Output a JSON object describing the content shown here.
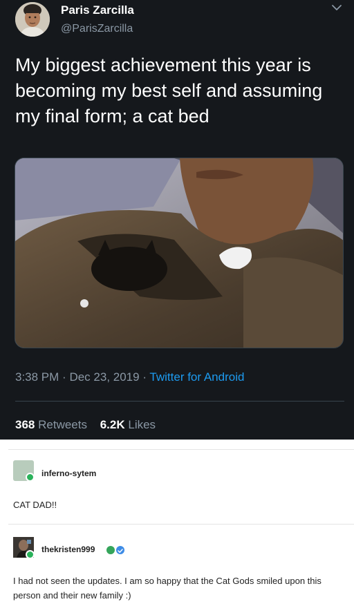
{
  "tweet": {
    "author_name": "Paris Zarcilla",
    "author_handle": "@ParisZarcilla",
    "text": "My biggest achievement this year is becoming my best self and assuming my final form; a cat bed",
    "time": "3:38 PM",
    "date": "Dec 23, 2019",
    "separator": "·",
    "source": "Twitter for Android",
    "retweets_count": "368",
    "retweets_label": "Retweets",
    "likes_count": "6.2K",
    "likes_label": "Likes",
    "colors": {
      "background": "#15181c",
      "link": "#1d9bf0",
      "muted": "#8b98a5"
    }
  },
  "reblog_chain": [
    {
      "blog": "inferno-sytem",
      "text": "CAT DAD!!"
    },
    {
      "blog": "thekristen999",
      "text": "I had not seen the updates. I am so happy that the Cat Gods smiled upon this person and their new family :)"
    }
  ],
  "icons": {
    "menu": "chevron-down-icon",
    "online": "online-dot-icon",
    "badges": [
      "verified-badge-icon",
      "verified-badge-icon"
    ]
  }
}
